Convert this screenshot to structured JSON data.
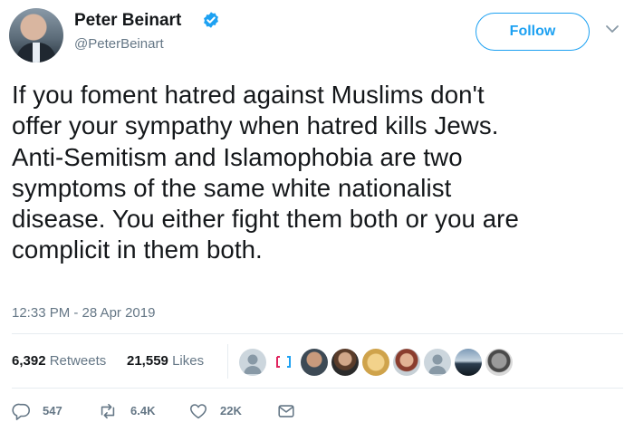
{
  "tweet": {
    "author_name": "Peter Beinart",
    "handle": "@PeterBeinart",
    "follow_label": "Follow",
    "text_lines": [
      "If you foment hatred against Muslims don't",
      "offer your sympathy when hatred kills Jews.",
      "Anti-Semitism and Islamophobia are two",
      "symptoms of the same white nationalist",
      "disease. You either fight them both or you are",
      "complicit in them both."
    ],
    "timestamp": "12:33 PM - 28 Apr 2019",
    "retweets_count": "6,392",
    "retweets_label": "Retweets",
    "likes_count": "21,559",
    "likes_label": "Likes",
    "actions": {
      "reply_count": "547",
      "retweet_count": "6.4K",
      "like_count": "22K"
    }
  },
  "colors": {
    "accent": "#1da1f2",
    "secondary_text": "#657786",
    "primary_text": "#14171a",
    "divider": "#e6ecf0"
  },
  "icons": [
    "verified-badge-icon",
    "chevron-down-icon",
    "reply-icon",
    "retweet-icon",
    "like-icon",
    "message-icon"
  ]
}
